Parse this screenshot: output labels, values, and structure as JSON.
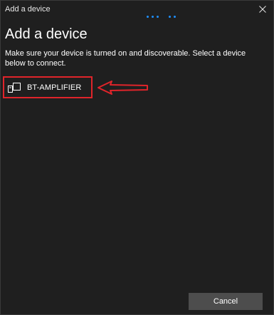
{
  "window": {
    "title": "Add a device"
  },
  "main": {
    "heading": "Add a device",
    "instruction": "Make sure your device is turned on and discoverable. Select a device below to connect.",
    "devices": [
      {
        "name": "BT-AMPLIFIER",
        "icon": "audio-device-icon"
      }
    ]
  },
  "footer": {
    "cancel_label": "Cancel"
  },
  "colors": {
    "background": "#1f1f1f",
    "text": "#ffffff",
    "annotation": "#e0242a",
    "button": "#4d4d4d",
    "progress": "#1e90ff"
  }
}
